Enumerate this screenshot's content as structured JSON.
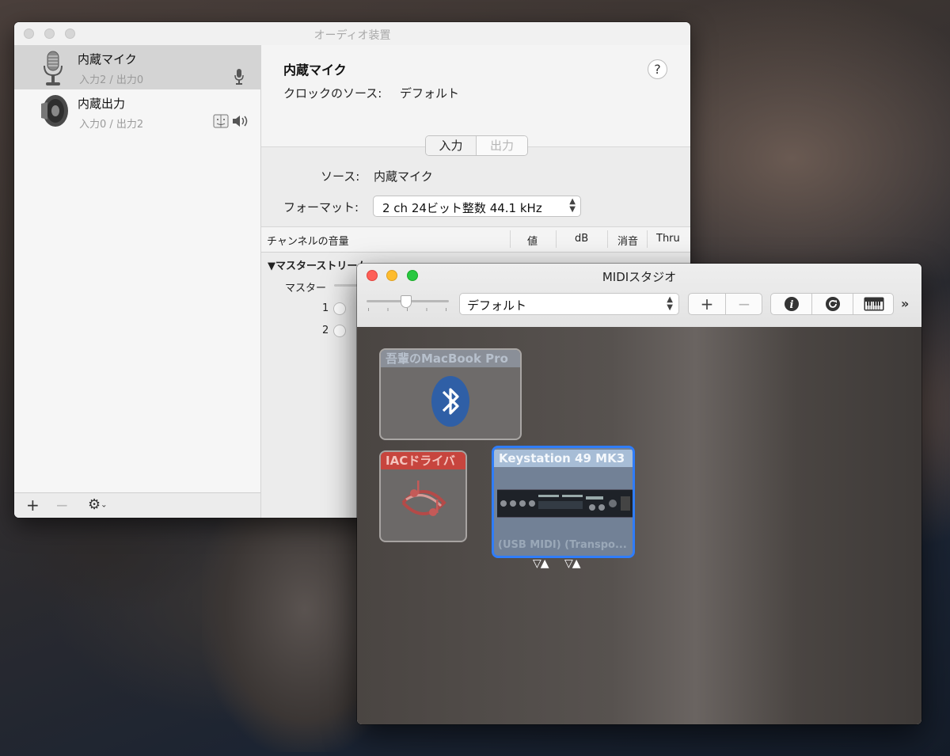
{
  "audio_window": {
    "title": "オーディオ装置",
    "devices": [
      {
        "name": "内蔵マイク",
        "io": "入力2 / 出力0",
        "icon": "microphone-icon",
        "selected": true
      },
      {
        "name": "内蔵出力",
        "io": "入力0 / 出力2",
        "icon": "speaker-icon",
        "selected": false
      }
    ],
    "bottom_bar": {
      "add": "+",
      "remove": "−"
    },
    "detail": {
      "device_title": "内蔵マイク",
      "clock_label": "クロックのソース:",
      "clock_value": "デフォルト",
      "help": "?",
      "tabs": [
        "入力",
        "出力"
      ],
      "active_tab": "入力",
      "source_label": "ソース:",
      "source_value": "内蔵マイク",
      "format_label": "フォーマット:",
      "format_value": "2 ch 24ビット整数 44.1 kHz",
      "table_headers": [
        "チャンネルの音量",
        "値",
        "dB",
        "消音",
        "Thru"
      ],
      "stream_title": "▼マスターストリーム",
      "channels": [
        "マスター",
        "1",
        "2"
      ]
    }
  },
  "midi_window": {
    "title": "MIDIスタジオ",
    "configuration": "デフォルト",
    "toolbar": {
      "add": "+",
      "remove": "−",
      "more": "»"
    },
    "devices": [
      {
        "name": "吾輩のMacBook Pro",
        "icon": "bluetooth-icon",
        "selected": false
      },
      {
        "name": "IACドライバ",
        "icon": "iac-driver-icon",
        "selected": false
      },
      {
        "name": "Keystation 49 MK3",
        "sub": "(USB MIDI) (Transpo...",
        "icon": "midi-interface-icon",
        "selected": true
      }
    ],
    "ports": [
      "▽▲",
      "▽▲"
    ]
  },
  "colors": {
    "close": "#fe5f57",
    "minimize": "#febc2e",
    "zoom": "#28c840",
    "selection_blue": "#2f7dfa",
    "iac_red": "#d6463c"
  }
}
